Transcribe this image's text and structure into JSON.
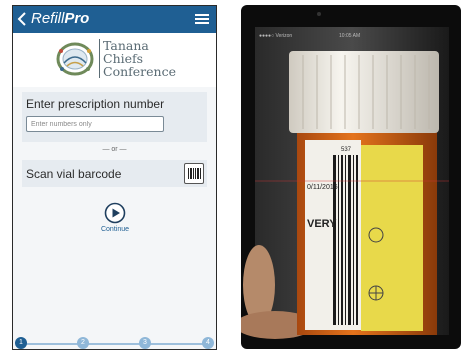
{
  "app": {
    "title_prefix": "Refill",
    "title_suffix": "Pro"
  },
  "logo": {
    "line1": "Tanana",
    "line2": "Chiefs",
    "line3": "Conference"
  },
  "prescription": {
    "label": "Enter prescription number",
    "placeholder": "Enter numbers only"
  },
  "divider_text": "— or —",
  "scan": {
    "label": "Scan vial barcode"
  },
  "continue": {
    "label": "Continue"
  },
  "steps": [
    "1",
    "2",
    "3",
    "4"
  ],
  "current_step": 1,
  "camera": {
    "status_carrier": "●●●●○ Verizon",
    "status_time": "10:05 AM",
    "label_text_1": "537",
    "label_text_2": "0/11/2016",
    "label_text_3": "VERY"
  },
  "colors": {
    "header": "#1f5f93",
    "accent": "#1f5f93",
    "panel": "#e6ebf0",
    "cap": "#f4f1ea",
    "bottle": "#e4731c",
    "warning_label": "#e8d94a"
  },
  "icons": {
    "back": "chevron-left-icon",
    "menu": "hamburger-menu-icon",
    "barcode": "barcode-icon",
    "continue": "play-circle-icon"
  }
}
